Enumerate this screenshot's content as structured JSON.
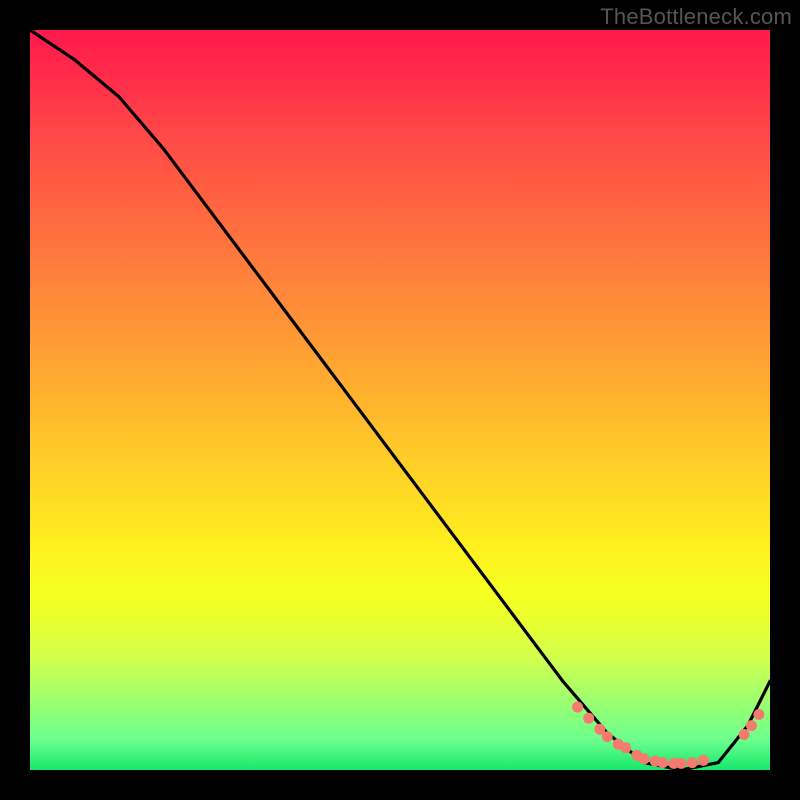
{
  "watermark": "TheBottleneck.com",
  "chart_data": {
    "type": "line",
    "title": "",
    "xlabel": "",
    "ylabel": "",
    "xlim": [
      0,
      100
    ],
    "ylim": [
      0,
      100
    ],
    "series": [
      {
        "name": "curve",
        "x": [
          0,
          6,
          12,
          18,
          24,
          30,
          36,
          42,
          48,
          54,
          60,
          66,
          72,
          78,
          83,
          88,
          93,
          97,
          100
        ],
        "y": [
          100,
          96,
          91,
          84,
          76,
          68,
          60,
          52,
          44,
          36,
          28,
          20,
          12,
          5,
          1,
          0,
          1,
          6,
          12
        ]
      }
    ],
    "markers": {
      "comment": "salmon dotted segment near the valley",
      "color": "#f57b6e",
      "points_x": [
        74,
        75.5,
        77,
        78,
        79.5,
        80.5,
        82,
        83,
        84.5,
        85.5,
        87,
        88,
        89.5,
        91,
        96.5,
        97.5,
        98.5
      ],
      "points_y": [
        8.5,
        7,
        5.5,
        4.5,
        3.5,
        3,
        2,
        1.5,
        1.2,
        1,
        0.9,
        0.9,
        1,
        1.3,
        4.8,
        6,
        7.5
      ]
    },
    "gradient_stops": [
      {
        "pos": 0.0,
        "color": "#ff1a4b"
      },
      {
        "pos": 0.25,
        "color": "#ff7a3d"
      },
      {
        "pos": 0.55,
        "color": "#ffd126"
      },
      {
        "pos": 0.78,
        "color": "#f3ff24"
      },
      {
        "pos": 0.96,
        "color": "#6bff8e"
      },
      {
        "pos": 1.0,
        "color": "#15e86b"
      }
    ]
  }
}
